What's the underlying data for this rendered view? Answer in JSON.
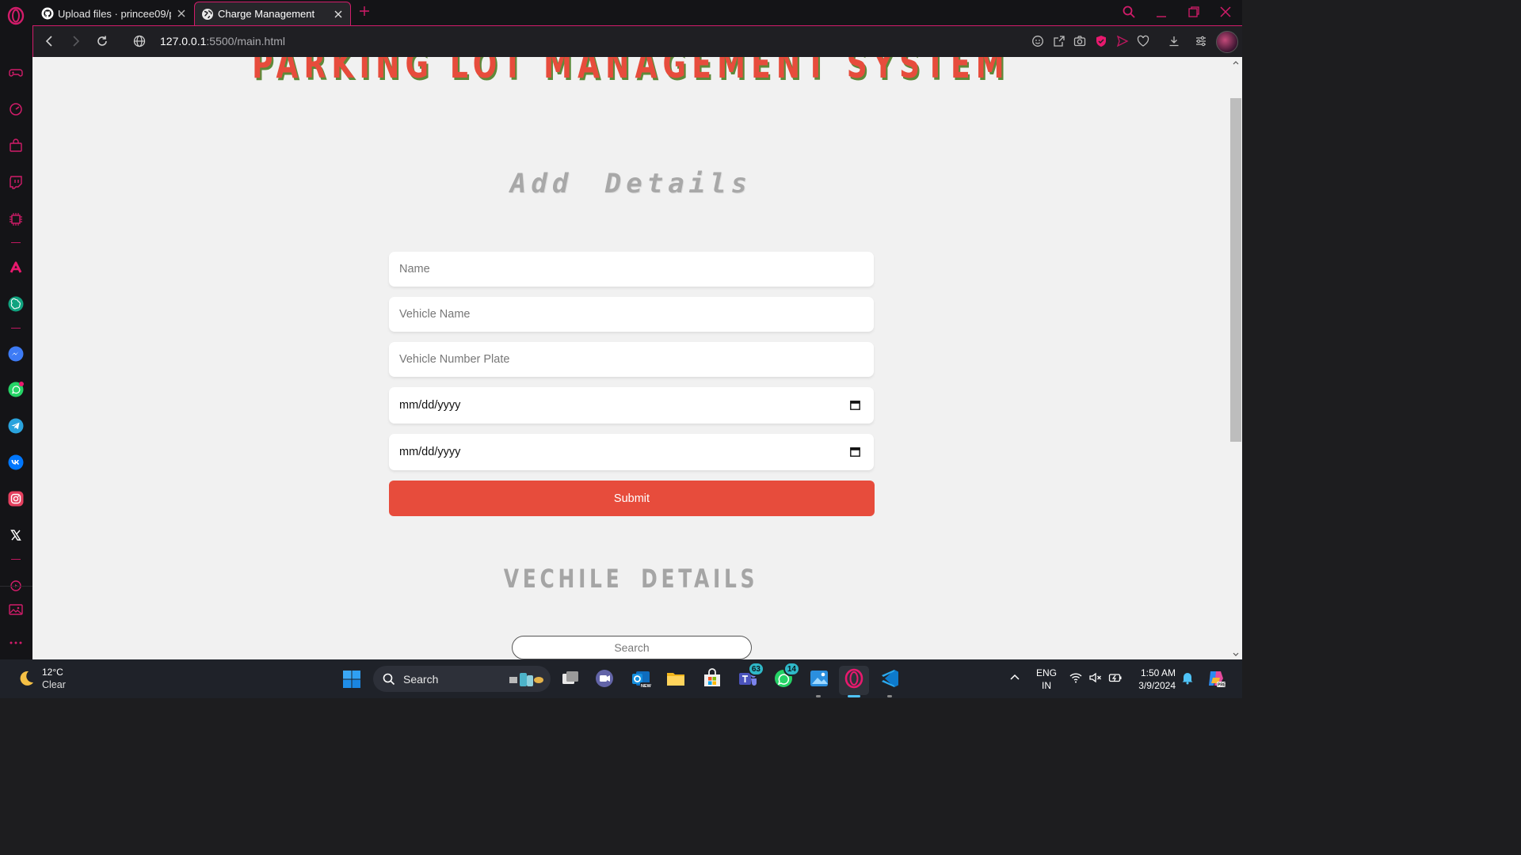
{
  "browser": {
    "tabs": [
      {
        "title": "Upload files · princee09/pa",
        "favicon": "github-icon"
      },
      {
        "title": "Charge Management",
        "favicon": "globe-icon",
        "active": true
      }
    ],
    "url_host": "127.0.0.1",
    "url_rest": ":5500/main.html",
    "accent_color": "#d21c6a"
  },
  "page": {
    "main_title": "PARKING LOT MANAGEMENT SYSTEM",
    "add_title": "Add Details",
    "form": {
      "name_placeholder": "Name",
      "vehicle_name_placeholder": "Vehicle Name",
      "plate_placeholder": "Vehicle Number Plate",
      "date_in_value": "mm/dd/yyyy",
      "date_out_value": "mm/dd/yyyy",
      "submit_label": "Submit"
    },
    "vehicle_title": "VECHILE DETAILS",
    "search_placeholder": "Search",
    "colors": {
      "primary": "#e74c3c",
      "title_shadow": "#5e8a3a",
      "heading_gray": "#a5a5a5"
    }
  },
  "taskbar": {
    "weather_temp": "12°C",
    "weather_desc": "Clear",
    "search_label": "Search",
    "badges": {
      "outlook_teams": "63",
      "whatsapp": "14"
    },
    "lang_line1": "ENG",
    "lang_line2": "IN",
    "time": "1:50 AM",
    "date": "3/9/2024"
  }
}
